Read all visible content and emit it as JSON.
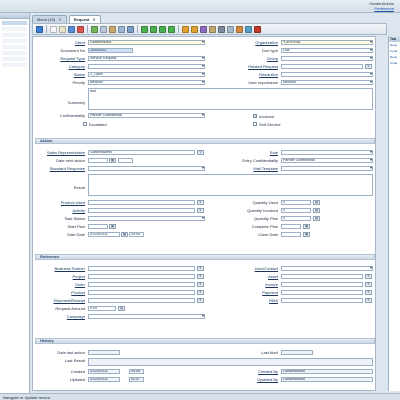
{
  "window": {
    "user_name": "GardenAdmin",
    "preference_link": "Preference"
  },
  "tabs": [
    {
      "label": "Menu (10)",
      "close": "✕"
    },
    {
      "label": "Request",
      "close": "✕"
    }
  ],
  "right_panel": {
    "title": "Tab",
    "links": [
      "Requ",
      "Upda",
      "Requ",
      "Upda"
    ]
  },
  "form": {
    "client": {
      "label": "Client",
      "value": "GardenWorld"
    },
    "organization": {
      "label": "Organization",
      "value": "*CENTRAL"
    },
    "document_no": {
      "label": "Document No",
      "value": "10000003"
    },
    "due_type": {
      "label": "Due type",
      "value": "Due"
    },
    "request_type": {
      "label": "Request Type",
      "value": "Service Request"
    },
    "group": {
      "label": "Group",
      "value": ""
    },
    "category": {
      "label": "Category",
      "value": ""
    },
    "related_request": {
      "label": "Related Request",
      "value": ""
    },
    "status": {
      "label": "Status",
      "value": "1_Open"
    },
    "resolution": {
      "label": "Resolution",
      "value": ""
    },
    "priority": {
      "label": "Priority",
      "value": "Medium"
    },
    "user_importance": {
      "label": "User Importance",
      "value": "Medium"
    },
    "summary": {
      "label": "Summary",
      "value": "test"
    },
    "confidentiality": {
      "label": "Confidentiality",
      "value": "Partner Confidential"
    },
    "invoiced": {
      "label": "Invoiced",
      "checked": true
    },
    "escalated": {
      "label": "Escalated",
      "checked": false
    },
    "self_service": {
      "label": "Self-Service",
      "checked": false
    }
  },
  "action": {
    "title": "Action",
    "sales_rep": {
      "label": "Sales Representative",
      "value": "GardenAdmin"
    },
    "role": {
      "label": "Role",
      "value": ""
    },
    "date_next_action": {
      "label": "Date next action",
      "value": ""
    },
    "entry_confidentiality": {
      "label": "Entry Confidentiality",
      "value": "Partner Confidential"
    },
    "standard_response": {
      "label": "Standard Response",
      "value": ""
    },
    "mail_template": {
      "label": "Mail Template",
      "value": ""
    },
    "result": {
      "label": "Result",
      "value": ""
    },
    "product_used": {
      "label": "Product Used",
      "value": ""
    },
    "quantity_used": {
      "label": "Quantity Used",
      "value": "0"
    },
    "activity": {
      "label": "Activity",
      "value": ""
    },
    "quantity_invoiced": {
      "label": "Quantity Invoiced",
      "value": "0"
    },
    "task_status": {
      "label": "Task Status",
      "value": ""
    },
    "quantity_plan": {
      "label": "Quantity Plan",
      "value": "0"
    },
    "start_plan": {
      "label": "Start Plan",
      "value": ""
    },
    "complete_plan": {
      "label": "Complete Plan",
      "value": ""
    },
    "start_date": {
      "label": "Start Date",
      "date": "01/24/2011",
      "time": "04:05"
    },
    "close_date": {
      "label": "Close Date",
      "value": ""
    }
  },
  "reference": {
    "title": "Reference",
    "business_partner": {
      "label": "Business Partner",
      "value": ""
    },
    "user_contact": {
      "label": "User/Contact",
      "value": ""
    },
    "project": {
      "label": "Project",
      "value": ""
    },
    "asset": {
      "label": "Asset",
      "value": ""
    },
    "order": {
      "label": "Order",
      "value": ""
    },
    "invoice": {
      "label": "Invoice",
      "value": ""
    },
    "product": {
      "label": "Product",
      "value": ""
    },
    "payment": {
      "label": "Payment",
      "value": ""
    },
    "shipment": {
      "label": "Shipment/Receipt",
      "value": ""
    },
    "rma": {
      "label": "RMA",
      "value": ""
    },
    "request_amount": {
      "label": "Request Amount",
      "value": "0.00"
    },
    "campaign": {
      "label": "Campaign",
      "value": ""
    }
  },
  "history": {
    "title": "History",
    "date_last_action": {
      "label": "Date last action",
      "value": ""
    },
    "last_alert": {
      "label": "Last Alert",
      "value": ""
    },
    "last_result": {
      "label": "Last Result",
      "value": ""
    },
    "created": {
      "label": "Created",
      "date": "01/24/2011",
      "time": "04:06"
    },
    "created_by": {
      "label": "Created By",
      "value": "GardenAdmin"
    },
    "updated": {
      "label": "Updated",
      "date": "01/25/2011",
      "time": "02:57"
    },
    "updated_by": {
      "label": "Updated By",
      "value": "GardenAdmin"
    }
  },
  "status_bar": {
    "text": "Navigate or Update record"
  },
  "icons": {
    "toolbar": [
      "help-icon",
      "new-icon",
      "copy-icon",
      "save-icon",
      "delete-icon",
      "refresh-icon",
      "find-icon",
      "attachment-icon",
      "history-icon",
      "grid-toggle-icon",
      "first-icon",
      "prev-icon",
      "next-icon",
      "last-icon",
      "parent-icon",
      "detail-icon",
      "report-icon",
      "archive-icon",
      "print-icon",
      "zoom-icon",
      "workflow-icon",
      "process-icon",
      "exit-icon"
    ]
  }
}
